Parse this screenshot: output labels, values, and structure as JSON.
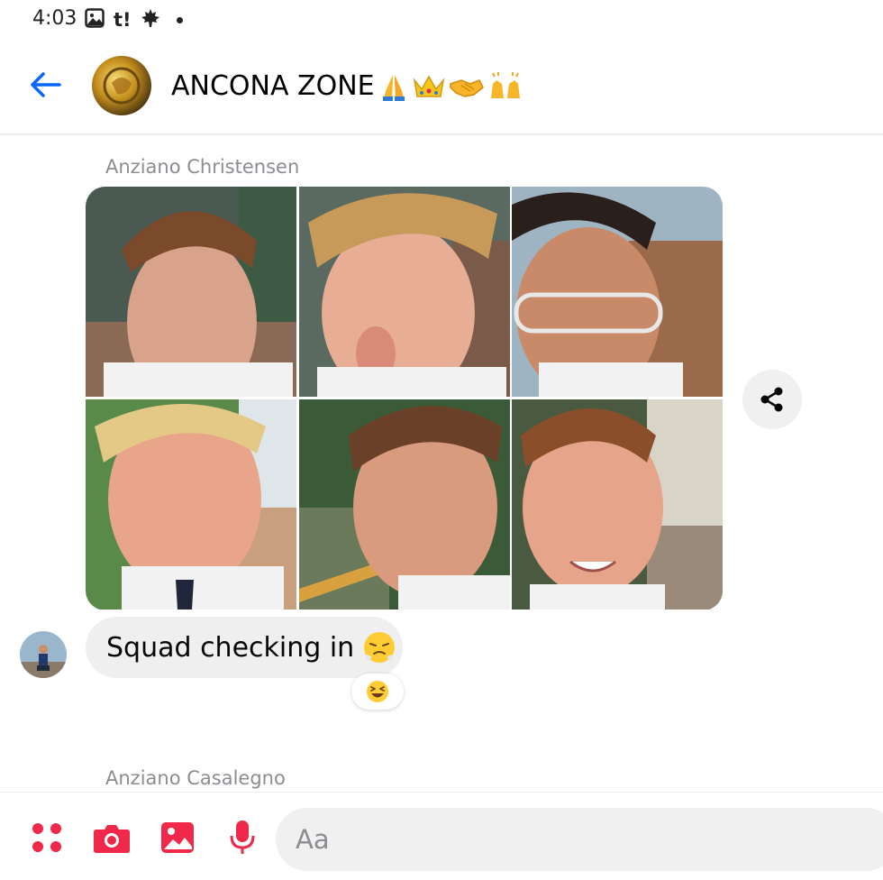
{
  "status_bar": {
    "time": "4:03",
    "t_icon_label": "t!"
  },
  "header": {
    "title": "ANCONA ZONE",
    "title_emojis": [
      "folded-hands",
      "crown",
      "handshake",
      "raising-hands"
    ]
  },
  "messages": [
    {
      "sender": "Anziano Christensen",
      "type": "photo-grid",
      "photo_count": 6
    },
    {
      "text": "Squad checking in",
      "emoji": "steam-nose-face",
      "reaction": "grinning-squinting-face"
    },
    {
      "sender": "Anziano Casalegno"
    }
  ],
  "composer": {
    "placeholder": "Aa",
    "icons": [
      "apps-icon",
      "camera-icon",
      "gallery-icon",
      "microphone-icon"
    ]
  },
  "colors": {
    "accent_blue": "#0866ff",
    "composer_red": "#f02849",
    "bubble_gray": "#efefef",
    "sender_gray": "#8a8d91"
  }
}
